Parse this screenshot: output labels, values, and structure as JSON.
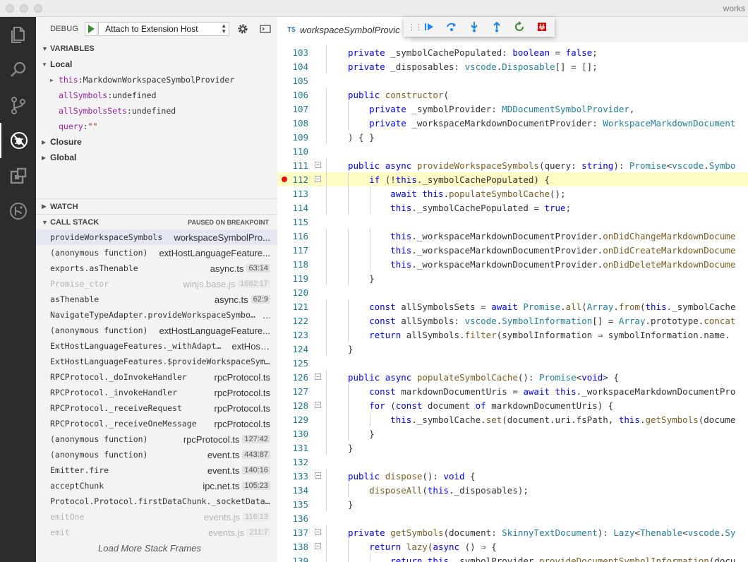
{
  "window": {
    "title": "works"
  },
  "activity_bar": {
    "items": [
      {
        "name": "explorer-icon"
      },
      {
        "name": "search-icon"
      },
      {
        "name": "source-control-icon"
      },
      {
        "name": "debug-icon",
        "active": true
      },
      {
        "name": "extensions-icon"
      },
      {
        "name": "remote-icon"
      }
    ]
  },
  "debug_toolbar": {
    "label": "DEBUG",
    "config": "Attach to Extension Host"
  },
  "variables": {
    "header": "VARIABLES",
    "local_label": "Local",
    "this_name": "this",
    "this_value": "MarkdownWorkspaceSymbolProvider",
    "allSymbols_name": "allSymbols",
    "allSymbols_value": "undefined",
    "allSymbolsSets_name": "allSymbolsSets",
    "allSymbolsSets_value": "undefined",
    "query_name": "query",
    "query_value": "\"\"",
    "closure_label": "Closure",
    "global_label": "Global"
  },
  "watch": {
    "header": "WATCH"
  },
  "call_stack": {
    "header": "CALL STACK",
    "status": "PAUSED ON BREAKPOINT",
    "frames": [
      {
        "fn": "provideWorkspaceSymbols",
        "file": "workspaceSymbolPro...",
        "line": ""
      },
      {
        "fn": "(anonymous function)",
        "file": "extHostLanguageFeature...",
        "line": ""
      },
      {
        "fn": "exports.asThenable",
        "file": "async.ts",
        "line": "63:14"
      },
      {
        "fn": "Promise_ctor",
        "file": "winjs.base.js",
        "line": "1662:17"
      },
      {
        "fn": "asThenable",
        "file": "async.ts",
        "line": "62:9"
      },
      {
        "fn": "NavigateTypeAdapter.provideWorkspaceSymbols",
        "file": "...",
        "line": ""
      },
      {
        "fn": "(anonymous function)",
        "file": "extHostLanguageFeature...",
        "line": ""
      },
      {
        "fn": "ExtHostLanguageFeatures._withAdapter",
        "file": "extHost...",
        "line": ""
      },
      {
        "fn": "ExtHostLanguageFeatures.$provideWorkspaceSymbols",
        "file": "",
        "line": ""
      },
      {
        "fn": "RPCProtocol._doInvokeHandler",
        "file": "rpcProtocol.ts",
        "line": ""
      },
      {
        "fn": "RPCProtocol._invokeHandler",
        "file": "rpcProtocol.ts",
        "line": ""
      },
      {
        "fn": "RPCProtocol._receiveRequest",
        "file": "rpcProtocol.ts",
        "line": ""
      },
      {
        "fn": "RPCProtocol._receiveOneMessage",
        "file": "rpcProtocol.ts",
        "line": ""
      },
      {
        "fn": "(anonymous function)",
        "file": "rpcProtocol.ts",
        "line": "127:42"
      },
      {
        "fn": "(anonymous function)",
        "file": "event.ts",
        "line": "443:87"
      },
      {
        "fn": "Emitter.fire",
        "file": "event.ts",
        "line": "140:16"
      },
      {
        "fn": "acceptChunk",
        "file": "ipc.net.ts",
        "line": "105:23"
      },
      {
        "fn": "Protocol.Protocol.firstDataChunk._socketDataListe",
        "file": "",
        "line": ""
      },
      {
        "fn": "emitOne",
        "file": "events.js",
        "line": "116:13"
      },
      {
        "fn": "emit",
        "file": "events.js",
        "line": "211:7"
      }
    ],
    "load_more": "Load More Stack Frames"
  },
  "editor": {
    "tab_lang": "TS",
    "tab_name": "workspaceSymbolProvic",
    "current_line": "112",
    "breakpoint_line": "112",
    "lines": [
      {
        "n": "103",
        "code": "private _symbolCachePopulated: boolean = false;"
      },
      {
        "n": "104",
        "code": "private _disposables: vscode.Disposable[] = [];"
      },
      {
        "n": "105",
        "code": ""
      },
      {
        "n": "106",
        "code": "public constructor("
      },
      {
        "n": "107",
        "code": "    private _symbolProvider: MDDocumentSymbolProvider,"
      },
      {
        "n": "108",
        "code": "    private _workspaceMarkdownDocumentProvider: WorkspaceMarkdownDocument"
      },
      {
        "n": "109",
        "code": ") { }"
      },
      {
        "n": "110",
        "code": ""
      },
      {
        "n": "111",
        "code": "public async provideWorkspaceSymbols(query: string): Promise<vscode.Symbo"
      },
      {
        "n": "112",
        "code": "    if (!this._symbolCachePopulated) {"
      },
      {
        "n": "113",
        "code": "        await this.populateSymbolCache();"
      },
      {
        "n": "114",
        "code": "        this._symbolCachePopulated = true;"
      },
      {
        "n": "115",
        "code": ""
      },
      {
        "n": "116",
        "code": "        this._workspaceMarkdownDocumentProvider.onDidChangeMarkdownDocume"
      },
      {
        "n": "117",
        "code": "        this._workspaceMarkdownDocumentProvider.onDidCreateMarkdownDocume"
      },
      {
        "n": "118",
        "code": "        this._workspaceMarkdownDocumentProvider.onDidDeleteMarkdownDocume"
      },
      {
        "n": "119",
        "code": "    }"
      },
      {
        "n": "120",
        "code": ""
      },
      {
        "n": "121",
        "code": "    const allSymbolsSets = await Promise.all(Array.from(this._symbolCache"
      },
      {
        "n": "122",
        "code": "    const allSymbols: vscode.SymbolInformation[] = Array.prototype.concat"
      },
      {
        "n": "123",
        "code": "    return allSymbols.filter(symbolInformation ⇒ symbolInformation.name."
      },
      {
        "n": "124",
        "code": "}"
      },
      {
        "n": "125",
        "code": ""
      },
      {
        "n": "126",
        "code": "public async populateSymbolCache(): Promise<void> {"
      },
      {
        "n": "127",
        "code": "    const markdownDocumentUris = await this._workspaceMarkdownDocumentPro"
      },
      {
        "n": "128",
        "code": "    for (const document of markdownDocumentUris) {"
      },
      {
        "n": "129",
        "code": "        this._symbolCache.set(document.uri.fsPath, this.getSymbols(docume"
      },
      {
        "n": "130",
        "code": "    }"
      },
      {
        "n": "131",
        "code": "}"
      },
      {
        "n": "132",
        "code": ""
      },
      {
        "n": "133",
        "code": "public dispose(): void {"
      },
      {
        "n": "134",
        "code": "    disposeAll(this._disposables);"
      },
      {
        "n": "135",
        "code": "}"
      },
      {
        "n": "136",
        "code": ""
      },
      {
        "n": "137",
        "code": "private getSymbols(document: SkinnyTextDocument): Lazy<Thenable<vscode.Sy"
      },
      {
        "n": "138",
        "code": "    return lazy(async () ⇒ {"
      },
      {
        "n": "139",
        "code": "        return this._symbolProvider.provideDocumentSymbolInformation(docu"
      }
    ],
    "fold_lines": [
      "111",
      "112",
      "126",
      "128",
      "133",
      "137",
      "138"
    ]
  },
  "colors": {
    "activity_bar": "#2c2c2c",
    "sidebar": "#f3f3f3",
    "current_line": "#fffcc5",
    "breakpoint": "#e51400",
    "keyword": "#0000ff",
    "type": "#267f99",
    "function": "#795e26",
    "line_number": "#237893"
  }
}
